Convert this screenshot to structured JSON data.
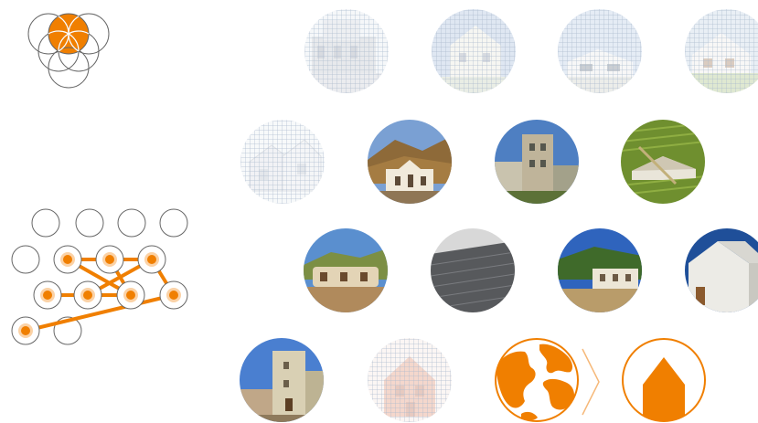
{
  "colors": {
    "accent": "#f07f00",
    "outline": "#666666",
    "sky": "#3d77c8",
    "grid": "#aab9cd"
  },
  "logo": {
    "icon": "overlapping-circles-logo-icon"
  },
  "network": {
    "icon": "node-network-diagram-icon"
  },
  "photos": [
    {
      "row": 1,
      "scene": "building-sketch",
      "faded": true
    },
    {
      "row": 1,
      "scene": "white-house",
      "faded": true
    },
    {
      "row": 1,
      "scene": "modern-house",
      "faded": true
    },
    {
      "row": 1,
      "scene": "aerial-house",
      "faded": true
    },
    {
      "row": 2,
      "scene": "house-sketch",
      "faded": true
    },
    {
      "row": 2,
      "scene": "mountain-winery",
      "faded": false
    },
    {
      "row": 2,
      "scene": "tower-building",
      "faded": false
    },
    {
      "row": 2,
      "scene": "vineyard-aerial",
      "faded": false
    },
    {
      "row": 3,
      "scene": "courtyard-fisheye",
      "faded": false
    },
    {
      "row": 3,
      "scene": "metal-roof",
      "faded": false
    },
    {
      "row": 3,
      "scene": "hillside-winery",
      "faded": false
    },
    {
      "row": 3,
      "scene": "white-gable-house",
      "faded": false
    },
    {
      "row": 4,
      "scene": "stone-tower",
      "faded": false
    },
    {
      "row": 4,
      "scene": "faded-red-house",
      "faded": true
    }
  ],
  "icons": {
    "globe": "globe-icon",
    "chevron": "chevron-right-icon",
    "house": "house-icon"
  }
}
